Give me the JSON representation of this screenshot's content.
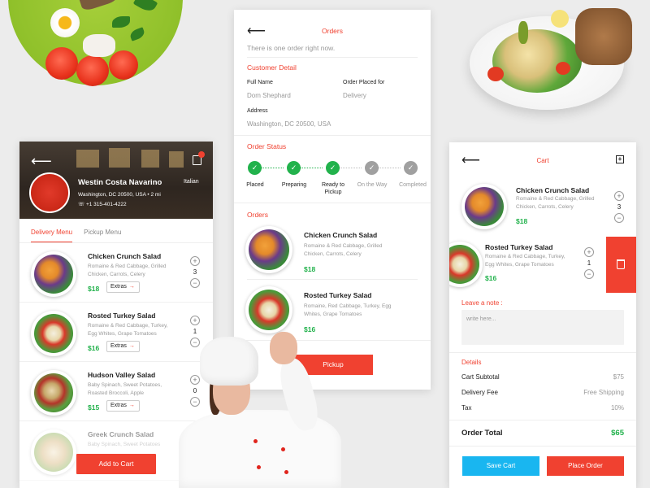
{
  "colors": {
    "accent": "#f04130",
    "price_green": "#22b24c",
    "save_blue": "#19b6f0"
  },
  "restaurant": {
    "name": "Westin Costa Navarino",
    "cuisine": "Italian",
    "address": "Washington, DC 20500, USA",
    "distance": "2 mi",
    "phone": "+1 315-401-4222"
  },
  "left_panel": {
    "tabs": [
      {
        "label": "Delivery Menu",
        "active": true
      },
      {
        "label": "Pickup Menu",
        "active": false
      }
    ],
    "items": [
      {
        "name": "Chicken Crunch Salad",
        "desc": "Romaine & Red Cabbage, Grilled Chicken, Carrots, Celery",
        "price": "$18",
        "extras": "Extras",
        "qty": "3"
      },
      {
        "name": "Rosted Turkey Salad",
        "desc": "Romaine & Red Cabbage, Turkey, Egg Whites, Grape Tomatoes",
        "price": "$16",
        "extras": "Extras",
        "qty": "1"
      },
      {
        "name": "Hudson Valley Salad",
        "desc": "Baby Spinach, Sweet Potatoes, Roasted Broccoli, Apple",
        "price": "$15",
        "extras": "Extras",
        "qty": "0"
      },
      {
        "name": "Greek Crunch Salad",
        "desc": "Baby Spinach, Sweet Potatoes"
      }
    ],
    "add_to_cart": "Add to Cart"
  },
  "orders_panel": {
    "title": "Orders",
    "note": "There is one order right now.",
    "customer_detail_title": "Customer Detail",
    "full_name_label": "Full Name",
    "full_name": "Dom Shephard",
    "placed_for_label": "Order Placed for",
    "placed_for": "Delivery",
    "address_label": "Address",
    "address": "Washington, DC 20500, USA",
    "status_title": "Order Status",
    "steps": [
      {
        "label": "Placed",
        "done": true
      },
      {
        "label": "Preparing",
        "done": true
      },
      {
        "label": "Ready to Pickup",
        "done": true
      },
      {
        "label": "On the Way",
        "done": false
      },
      {
        "label": "Completed",
        "done": false
      }
    ],
    "orders_title": "Orders",
    "orders": [
      {
        "name": "Chicken Crunch Salad",
        "desc": "Romaine & Red Cabbage, Grilled Chicken, Carrots, Celery",
        "price": "$18"
      },
      {
        "name": "Rosted Turkey Salad",
        "desc": "Romaine, Red Cabbage, Turkey, Egg Whites, Grape Tomatoes",
        "price": "$16"
      }
    ],
    "pickup": "Pickup"
  },
  "cart_panel": {
    "title": "Cart",
    "items": [
      {
        "name": "Chicken Crunch Salad",
        "desc": "Romaine & Red Cabbage, Grilled Chicken, Carrots, Celery",
        "price": "$18",
        "qty": "3"
      },
      {
        "name": "Rosted Turkey Salad",
        "desc": "Romaine & Red Cabbage, Turkey, Egg Whites, Grape Tomatoes",
        "price": "$16",
        "qty": "1"
      }
    ],
    "note_label": "Leave a note :",
    "note_placeholder": "write here...",
    "details_title": "Details",
    "subtotal_label": "Cart Subtotal",
    "subtotal": "$75",
    "delivery_label": "Delivery Fee",
    "delivery": "Free Shipping",
    "tax_label": "Tax",
    "tax": "10%",
    "total_label": "Order Total",
    "total": "$65",
    "save_cart": "Save Cart",
    "place_order": "Place Order"
  }
}
